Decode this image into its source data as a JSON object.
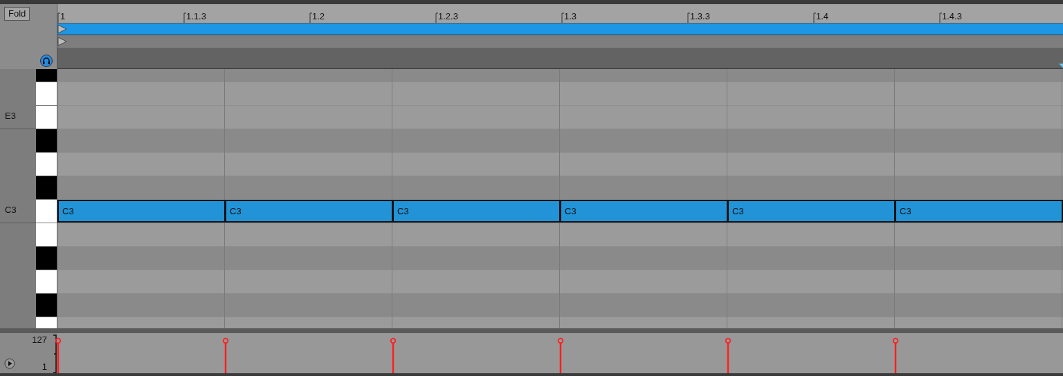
{
  "fold_button": "Fold",
  "ruler": [
    "1",
    "1.1.3",
    "1.2",
    "1.2.3",
    "1.3",
    "1.3.3",
    "1.4",
    "1.4.3"
  ],
  "key_groups": [
    {
      "label": "E3",
      "keys": [
        {
          "kind": "black"
        },
        {
          "kind": "white"
        },
        {
          "kind": "white"
        }
      ]
    },
    {
      "label": "C3",
      "keys": [
        {
          "kind": "black"
        },
        {
          "kind": "white"
        },
        {
          "kind": "black"
        },
        {
          "kind": "white",
          "notes": [
            {
              "label": "C3"
            },
            {
              "label": "C3"
            },
            {
              "label": "C3"
            },
            {
              "label": "C3"
            },
            {
              "label": "C3"
            },
            {
              "label": "C3"
            }
          ]
        }
      ]
    },
    {
      "keys": [
        {
          "kind": "white"
        },
        {
          "kind": "black"
        },
        {
          "kind": "white"
        },
        {
          "kind": "black"
        },
        {
          "kind": "white"
        }
      ]
    }
  ],
  "velocity": {
    "max": "127",
    "min": "1"
  }
}
